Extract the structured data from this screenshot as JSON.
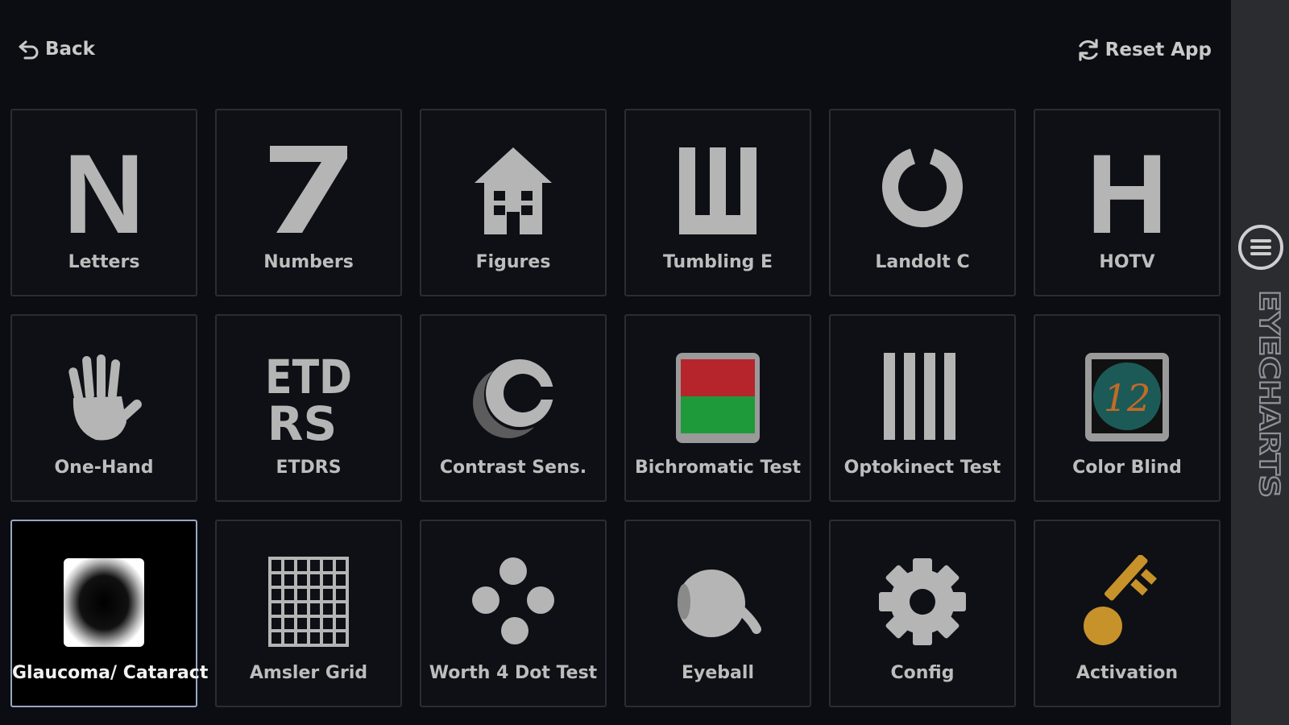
{
  "topbar": {
    "back_label": "Back",
    "reset_label": "Reset App"
  },
  "tiles": [
    {
      "label": "Letters",
      "icon": "letter-n-icon"
    },
    {
      "label": "Numbers",
      "icon": "number-seven-icon"
    },
    {
      "label": "Figures",
      "icon": "house-icon"
    },
    {
      "label": "Tumbling E",
      "icon": "tumbling-e-icon"
    },
    {
      "label": "Landolt C",
      "icon": "landolt-c-icon"
    },
    {
      "label": "HOTV",
      "icon": "letter-h-icon"
    },
    {
      "label": "One-Hand",
      "icon": "hand-icon"
    },
    {
      "label": "ETDRS",
      "icon": "etdrs-icon"
    },
    {
      "label": "Contrast Sens.",
      "icon": "contrast-c-icon"
    },
    {
      "label": "Bichromatic Test",
      "icon": "red-green-icon"
    },
    {
      "label": "Optokinect Test",
      "icon": "stripes-icon"
    },
    {
      "label": "Color Blind",
      "icon": "ishihara-plate-icon"
    },
    {
      "label": "Glaucoma/ Cataract",
      "icon": "dark-spot-icon",
      "selected": true
    },
    {
      "label": "Amsler Grid",
      "icon": "grid-icon"
    },
    {
      "label": "Worth 4 Dot Test",
      "icon": "four-dots-icon"
    },
    {
      "label": "Eyeball",
      "icon": "eyeball-icon"
    },
    {
      "label": "Config",
      "icon": "gear-icon"
    },
    {
      "label": "Activation",
      "icon": "key-icon"
    }
  ],
  "icon_text": {
    "letter": "N",
    "number": "7",
    "hotv": "H",
    "etdrs_top": "ETD",
    "etdrs_bottom": "RS",
    "plate_number": "12"
  },
  "sidebar": {
    "brand": "EYECHARTS"
  },
  "colors": {
    "background": "#0b0d12",
    "tile_bg": "#0e1015",
    "tile_border": "#2a2d33",
    "selected_border": "#9aa6c6",
    "icon_gray": "#b5b5b5",
    "sidebar_bg": "#2a2c30",
    "bichromatic_red": "#b6252c",
    "bichromatic_green": "#1f9a3a",
    "plate_teal": "#1c5a57",
    "plate_orange": "#c56a26",
    "key_gold": "#c8922a"
  }
}
